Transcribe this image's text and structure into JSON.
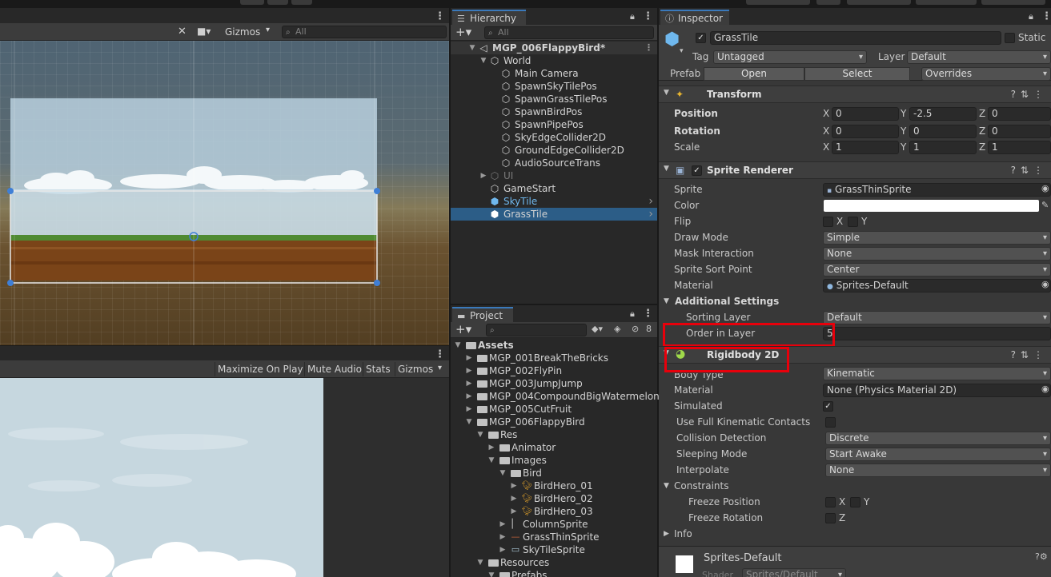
{
  "scene": {
    "toolbar": {
      "gizmos_label": "Gizmos",
      "search_placeholder": "All"
    }
  },
  "game": {
    "toolbar": {
      "maximize_label": "Maximize On Play",
      "mute_label": "Mute Audio",
      "stats_label": "Stats",
      "gizmos_label": "Gizmos"
    }
  },
  "hierarchy": {
    "tab_label": "Hierarchy",
    "search_placeholder": "All",
    "items": [
      {
        "label": "MGP_006FlappyBird*",
        "depth": 0,
        "icon": "unity-scene-icon",
        "expanded": true,
        "style": "bold"
      },
      {
        "label": "World",
        "depth": 1,
        "icon": "cube-icon",
        "expanded": true,
        "style": ""
      },
      {
        "label": "Main Camera",
        "depth": 2,
        "icon": "cube-icon",
        "style": ""
      },
      {
        "label": "SpawnSkyTilePos",
        "depth": 2,
        "icon": "cube-icon",
        "style": ""
      },
      {
        "label": "SpawnGrassTilePos",
        "depth": 2,
        "icon": "cube-icon",
        "style": ""
      },
      {
        "label": "SpawnBirdPos",
        "depth": 2,
        "icon": "cube-icon",
        "style": ""
      },
      {
        "label": "SpawnPipePos",
        "depth": 2,
        "icon": "cube-icon",
        "style": ""
      },
      {
        "label": "SkyEdgeCollider2D",
        "depth": 2,
        "icon": "cube-icon",
        "style": ""
      },
      {
        "label": "GroundEdgeCollider2D",
        "depth": 2,
        "icon": "cube-icon",
        "style": ""
      },
      {
        "label": "AudioSourceTrans",
        "depth": 2,
        "icon": "cube-icon",
        "style": ""
      },
      {
        "label": "UI",
        "depth": 1,
        "icon": "cube-icon",
        "collapsed": true,
        "style": "dim"
      },
      {
        "label": "GameStart",
        "depth": 1,
        "icon": "cube-icon",
        "style": ""
      },
      {
        "label": "SkyTile",
        "depth": 1,
        "icon": "prefab-icon",
        "style": "blue",
        "more": true
      },
      {
        "label": "GrassTile",
        "depth": 1,
        "icon": "prefab-icon",
        "style": "selected",
        "more": true
      }
    ]
  },
  "project": {
    "tab_label": "Project",
    "hidden_count": "8",
    "items": [
      {
        "label": "Assets",
        "depth": 0,
        "type": "folder",
        "expanded": true,
        "bold": true
      },
      {
        "label": "MGP_001BreakTheBricks",
        "depth": 1,
        "type": "folder",
        "collapsed": true
      },
      {
        "label": "MGP_002FlyPin",
        "depth": 1,
        "type": "folder",
        "collapsed": true
      },
      {
        "label": "MGP_003JumpJump",
        "depth": 1,
        "type": "folder",
        "collapsed": true
      },
      {
        "label": "MGP_004CompoundBigWatermelon",
        "depth": 1,
        "type": "folder",
        "collapsed": true
      },
      {
        "label": "MGP_005CutFruit",
        "depth": 1,
        "type": "folder",
        "collapsed": true
      },
      {
        "label": "MGP_006FlappyBird",
        "depth": 1,
        "type": "folder",
        "expanded": true
      },
      {
        "label": "Res",
        "depth": 2,
        "type": "folder",
        "expanded": true
      },
      {
        "label": "Animator",
        "depth": 3,
        "type": "folder",
        "collapsed": true
      },
      {
        "label": "Images",
        "depth": 3,
        "type": "folder",
        "expanded": true
      },
      {
        "label": "Bird",
        "depth": 4,
        "type": "folder",
        "expanded": true
      },
      {
        "label": "BirdHero_01",
        "depth": 5,
        "type": "sprite-bird",
        "collapsed": true
      },
      {
        "label": "BirdHero_02",
        "depth": 5,
        "type": "sprite-bird",
        "collapsed": true
      },
      {
        "label": "BirdHero_03",
        "depth": 5,
        "type": "sprite-bird",
        "collapsed": true
      },
      {
        "label": "ColumnSprite",
        "depth": 4,
        "type": "sprite-column",
        "collapsed": true
      },
      {
        "label": "GrassThinSprite",
        "depth": 4,
        "type": "sprite-grass",
        "collapsed": true
      },
      {
        "label": "SkyTileSprite",
        "depth": 4,
        "type": "sprite-sky",
        "collapsed": true
      },
      {
        "label": "Resources",
        "depth": 2,
        "type": "folder",
        "expanded": true
      },
      {
        "label": "Prefabs",
        "depth": 3,
        "type": "folder",
        "expanded": true
      }
    ]
  },
  "inspector": {
    "tab_label": "Inspector",
    "object_name": "GrassTile",
    "static_label": "Static",
    "tag_label": "Tag",
    "tag_value": "Untagged",
    "layer_label": "Layer",
    "layer_value": "Default",
    "prefab_label": "Prefab",
    "open_label": "Open",
    "select_label": "Select",
    "overrides_label": "Overrides",
    "transform": {
      "title": "Transform",
      "position_label": "Position",
      "rotation_label": "Rotation",
      "scale_label": "Scale",
      "position": {
        "x": "0",
        "y": "-2.5",
        "z": "0"
      },
      "rotation": {
        "x": "0",
        "y": "0",
        "z": "0"
      },
      "scale": {
        "x": "1",
        "y": "1",
        "z": "1"
      }
    },
    "sprite_renderer": {
      "title": "Sprite Renderer",
      "sprite_label": "Sprite",
      "sprite_value": "GrassThinSprite",
      "color_label": "Color",
      "color_value": "#ffffff",
      "flip_label": "Flip",
      "flip_x": "X",
      "flip_y": "Y",
      "draw_mode_label": "Draw Mode",
      "draw_mode_value": "Simple",
      "mask_label": "Mask Interaction",
      "mask_value": "None",
      "sort_point_label": "Sprite Sort Point",
      "sort_point_value": "Center",
      "material_label": "Material",
      "material_value": "Sprites-Default",
      "additional_label": "Additional Settings",
      "sorting_layer_label": "Sorting Layer",
      "sorting_layer_value": "Default",
      "order_label": "Order in Layer",
      "order_value": "5"
    },
    "rigidbody": {
      "title": "Rigidbody 2D",
      "body_type_label": "Body Type",
      "body_type_value": "Kinematic",
      "material_label": "Material",
      "material_value": "None (Physics Material 2D)",
      "simulated_label": "Simulated",
      "kinematic_contacts_label": "Use Full Kinematic Contacts",
      "collision_label": "Collision Detection",
      "collision_value": "Discrete",
      "sleeping_label": "Sleeping Mode",
      "sleeping_value": "Start Awake",
      "interpolate_label": "Interpolate",
      "interpolate_value": "None",
      "constraints_label": "Constraints",
      "freeze_pos_label": "Freeze Position",
      "freeze_rot_label": "Freeze Rotation",
      "x": "X",
      "y": "Y",
      "z": "Z",
      "info_label": "Info"
    },
    "material_footer": {
      "name": "Sprites-Default",
      "shader_label": "Shader",
      "shader_value": "Sprites/Default"
    }
  },
  "colors": {
    "selection": "#2c5d87",
    "highlight_box": "#e8000b",
    "prefab_blue": "#6fb8ee"
  }
}
